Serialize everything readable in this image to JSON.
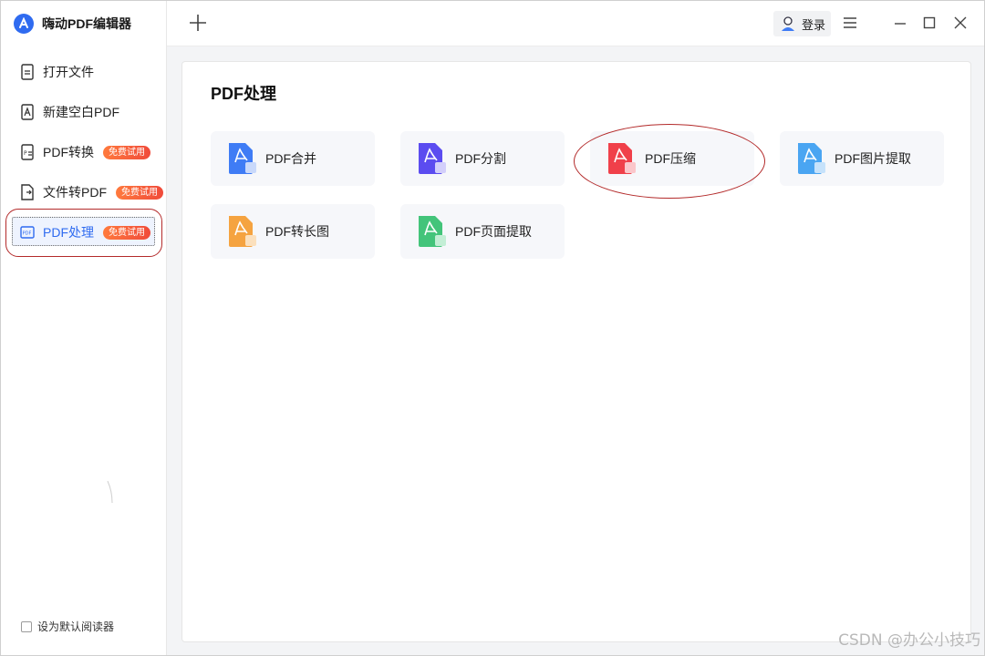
{
  "app": {
    "title": "嗨动PDF编辑器"
  },
  "sidebar": {
    "items": [
      {
        "label": "打开文件",
        "badge": ""
      },
      {
        "label": "新建空白PDF",
        "badge": ""
      },
      {
        "label": "PDF转换",
        "badge": "免费试用"
      },
      {
        "label": "文件转PDF",
        "badge": "免费试用"
      },
      {
        "label": "PDF处理",
        "badge": "免费试用",
        "active": true
      }
    ],
    "default_reader_label": "设为默认阅读器"
  },
  "topbar": {
    "login_label": "登录"
  },
  "main": {
    "title": "PDF处理",
    "tools": [
      {
        "label": "PDF合并",
        "color": "#3f7cf5"
      },
      {
        "label": "PDF分割",
        "color": "#5b4cf0"
      },
      {
        "label": "PDF压缩",
        "color": "#f0404a"
      },
      {
        "label": "PDF图片提取",
        "color": "#4aa5f2"
      },
      {
        "label": "PDF转长图",
        "color": "#f5a340"
      },
      {
        "label": "PDF页面提取",
        "color": "#43c47a"
      }
    ]
  },
  "watermark": "CSDN @办公小技巧",
  "colors": {
    "accent": "#2f6bf0",
    "annotation": "#b32a2a"
  }
}
